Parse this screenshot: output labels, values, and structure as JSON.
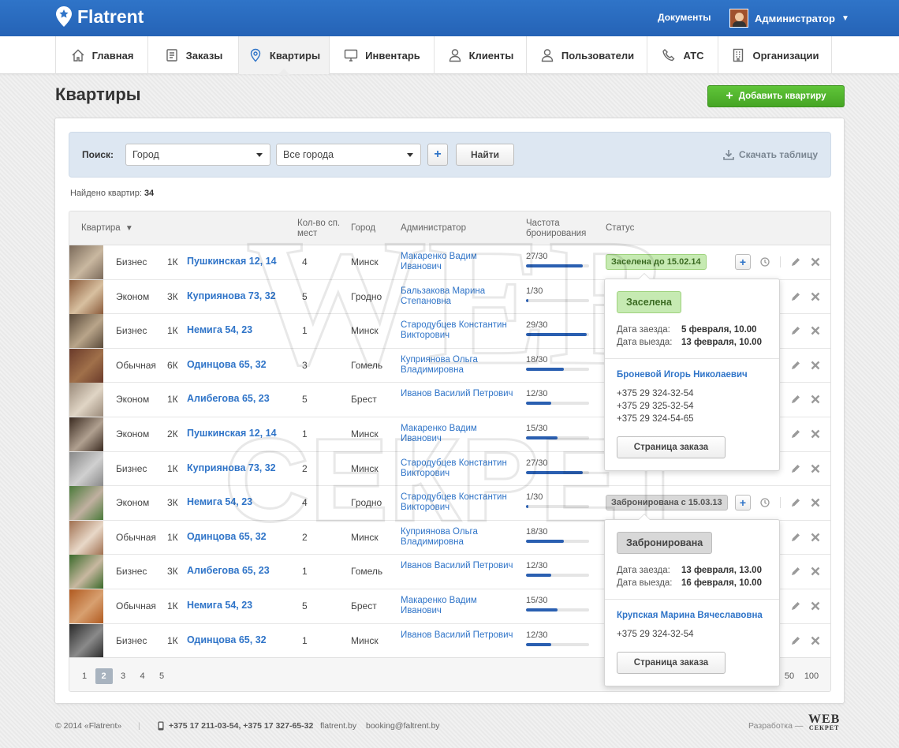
{
  "header": {
    "brand": "Flatrent",
    "documents": "Документы",
    "admin": "Администратор"
  },
  "nav": [
    {
      "label": "Главная",
      "icon": "home-icon",
      "width": 117
    },
    {
      "label": "Заказы",
      "icon": "document-icon",
      "width": 115
    },
    {
      "label": "Квартиры",
      "icon": "map-pin-icon",
      "width": 115,
      "active": true
    },
    {
      "label": "Инвентарь",
      "icon": "monitor-icon",
      "width": 133
    },
    {
      "label": "Клиенты",
      "icon": "user-icon",
      "width": 117
    },
    {
      "label": "Пользователи",
      "icon": "users-icon",
      "width": 153
    },
    {
      "label": "АТС",
      "icon": "phone-icon",
      "width": 90
    },
    {
      "label": "Организации",
      "icon": "building-icon",
      "width": 144
    }
  ],
  "page": {
    "title": "Квартиры",
    "add_button": "Добавить квартиру"
  },
  "search": {
    "label": "Поиск:",
    "field_value": "Город",
    "city_value": "Все города",
    "add_filter": "+",
    "find_button": "Найти",
    "download": "Скачать таблицу"
  },
  "found": {
    "label": "Найдено квартир:",
    "count": "34"
  },
  "table": {
    "headers": {
      "apartment": "Квартира",
      "beds": "Кол-во сп. мест",
      "city": "Город",
      "admin": "Администратор",
      "frequency": "Частота бронирования",
      "status": "Статус"
    },
    "rows": [
      {
        "type": "Бизнес",
        "rooms": "1К",
        "address": "Пушкинская 12, 14",
        "beds": "4",
        "city": "Минск",
        "admin": "Макаренко Вадим Иванович",
        "freq": "27/30",
        "fill": 0.9,
        "status": "Заселена до 15.02.14",
        "status_kind": "green",
        "photo": [
          "#7b6a5a",
          "#c9b8a0"
        ]
      },
      {
        "type": "Эконом",
        "rooms": "3К",
        "address": "Куприянова 73, 32",
        "beds": "5",
        "city": "Гродно",
        "admin": "Бальзакова Марина Степановна",
        "freq": "1/30",
        "fill": 0.033,
        "status": "",
        "photo": [
          "#8a5a3a",
          "#d8c0a0"
        ]
      },
      {
        "type": "Бизнес",
        "rooms": "1К",
        "address": "Немига 54, 23",
        "beds": "1",
        "city": "Минск",
        "admin": "Стародубцев Константин Викторович",
        "freq": "29/30",
        "fill": 0.967,
        "status": "",
        "photo": [
          "#5a4a3a",
          "#b9a58a"
        ]
      },
      {
        "type": "Обычная",
        "rooms": "6К",
        "address": "Одинцова 65, 32",
        "beds": "3",
        "city": "Гомель",
        "admin": "Куприянова Ольга Владимировна",
        "freq": "18/30",
        "fill": 0.6,
        "status": "",
        "photo": [
          "#6a3a2a",
          "#a0704a"
        ]
      },
      {
        "type": "Эконом",
        "rooms": "1К",
        "address": "Алибегова 65, 23",
        "beds": "5",
        "city": "Брест",
        "admin": "Иванов Василий Петрович",
        "freq": "12/30",
        "fill": 0.4,
        "status": "",
        "photo": [
          "#9a8a7a",
          "#e0d5c5"
        ]
      },
      {
        "type": "Эконом",
        "rooms": "2К",
        "address": "Пушкинская 12, 14",
        "beds": "1",
        "city": "Минск",
        "admin": "Макаренко Вадим Иванович",
        "freq": "15/30",
        "fill": 0.5,
        "status": "",
        "photo": [
          "#3a2a20",
          "#b0a090"
        ]
      },
      {
        "type": "Бизнес",
        "rooms": "1К",
        "address": "Куприянова 73, 32",
        "beds": "2",
        "city": "Минск",
        "admin": "Стародубцев Константин Викторович",
        "freq": "27/30",
        "fill": 0.9,
        "status": "",
        "photo": [
          "#888888",
          "#d0d0d0"
        ]
      },
      {
        "type": "Эконом",
        "rooms": "3К",
        "address": "Немига 54, 23",
        "beds": "4",
        "city": "Гродно",
        "admin": "Стародубцев Константин Викторович",
        "freq": "1/30",
        "fill": 0.033,
        "status": "Забронирована с 15.03.13",
        "status_kind": "gray",
        "photo": [
          "#4a7a3a",
          "#c0b0a0"
        ]
      },
      {
        "type": "Обычная",
        "rooms": "1К",
        "address": "Одинцова 65, 32",
        "beds": "2",
        "city": "Минск",
        "admin": "Куприянова Ольга Владимировна",
        "freq": "18/30",
        "fill": 0.6,
        "status": "",
        "photo": [
          "#a07050",
          "#e8d8c8"
        ]
      },
      {
        "type": "Бизнес",
        "rooms": "3К",
        "address": "Алибегова 65, 23",
        "beds": "1",
        "city": "Гомель",
        "admin": "Иванов Василий Петрович",
        "freq": "12/30",
        "fill": 0.4,
        "status": "",
        "photo": [
          "#3a6a2a",
          "#c8b8a0"
        ]
      },
      {
        "type": "Обычная",
        "rooms": "1К",
        "address": "Немига 54, 23",
        "beds": "5",
        "city": "Брест",
        "admin": "Макаренко Вадим Иванович",
        "freq": "15/30",
        "fill": 0.5,
        "status": "",
        "photo": [
          "#b05a20",
          "#d8a070"
        ]
      },
      {
        "type": "Бизнес",
        "rooms": "1К",
        "address": "Одинцова 65, 32",
        "beds": "1",
        "city": "Минск",
        "admin": "Иванов Василий Петрович",
        "freq": "12/30",
        "fill": 0.4,
        "status": "",
        "photo": [
          "#2a2a2a",
          "#8a8a8a"
        ]
      }
    ]
  },
  "pager": {
    "pages": [
      "1",
      "2",
      "3",
      "4",
      "5"
    ],
    "active": "2",
    "per_page": [
      "50",
      "100"
    ]
  },
  "popup1": {
    "badge": "Заселена",
    "checkin_label": "Дата заезда:",
    "checkin": "5 февраля, 10.00",
    "checkout_label": "Дата выезда:",
    "checkout": "13 февраля, 10.00",
    "client": "Броневой Игорь Николаевич",
    "phones": [
      "+375 29 324-32-54",
      "+375 29 325-32-54",
      "+375 29 324-54-65"
    ],
    "button": "Страница заказа"
  },
  "popup2": {
    "badge": "Забронирована",
    "checkin_label": "Дата заезда:",
    "checkin": "13 февраля, 13.00",
    "checkout_label": "Дата выезда:",
    "checkout": "16 февраля, 10.00",
    "client": "Крупская Марина Вячеславовна",
    "phones": [
      "+375 29 324-32-54"
    ],
    "button": "Страница заказа"
  },
  "footer": {
    "copyright": "© 2014 «Flatrent»",
    "phones": "+375 17 211-03-54, +375 17 327-65-32",
    "site": "flatrent.by",
    "email": "booking@faltrent.by",
    "developer": "Разработка —",
    "dev_logo_top": "WEB",
    "dev_logo_bottom": "СЕКРЕТ"
  },
  "watermark": {
    "line1": "WEB",
    "line2": "СЕКРЕТ"
  }
}
